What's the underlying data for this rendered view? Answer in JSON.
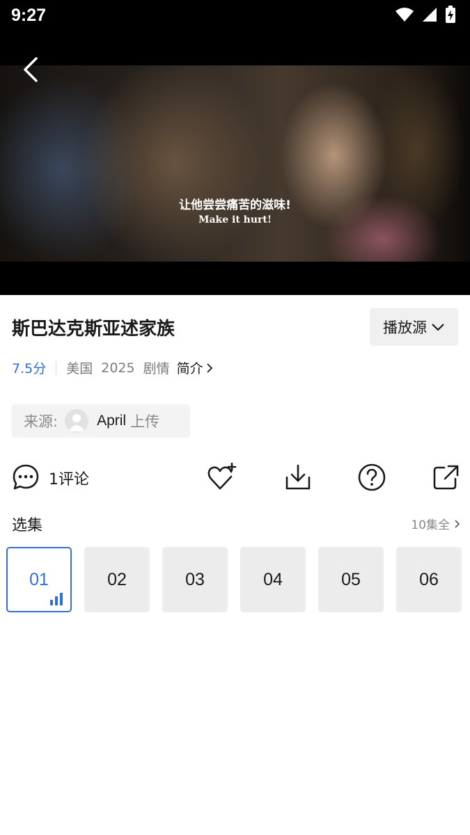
{
  "status_bar": {
    "time": "9:27"
  },
  "video": {
    "subtitle_cn": "让他尝尝痛苦的滋味!",
    "subtitle_en": "Make it hurt!"
  },
  "show": {
    "title": "斯巴达克斯亚述家族",
    "score": "7.5分",
    "region": "美国",
    "year": "2025",
    "genre": "剧情",
    "intro_label": "简介"
  },
  "source_button": {
    "label": "播放源"
  },
  "uploader": {
    "label": "来源:",
    "name": "April",
    "suffix": "上传"
  },
  "actions": {
    "comment_label": "1评论"
  },
  "episodes_section": {
    "title": "选集",
    "total_label": "10集全",
    "items": [
      {
        "label": "01",
        "active": true
      },
      {
        "label": "02",
        "active": false
      },
      {
        "label": "03",
        "active": false
      },
      {
        "label": "04",
        "active": false
      },
      {
        "label": "05",
        "active": false
      },
      {
        "label": "06",
        "active": false
      }
    ]
  },
  "colors": {
    "accent": "#2f6fd6",
    "chip_bg": "#ececec",
    "muted": "#7a7a7a"
  }
}
